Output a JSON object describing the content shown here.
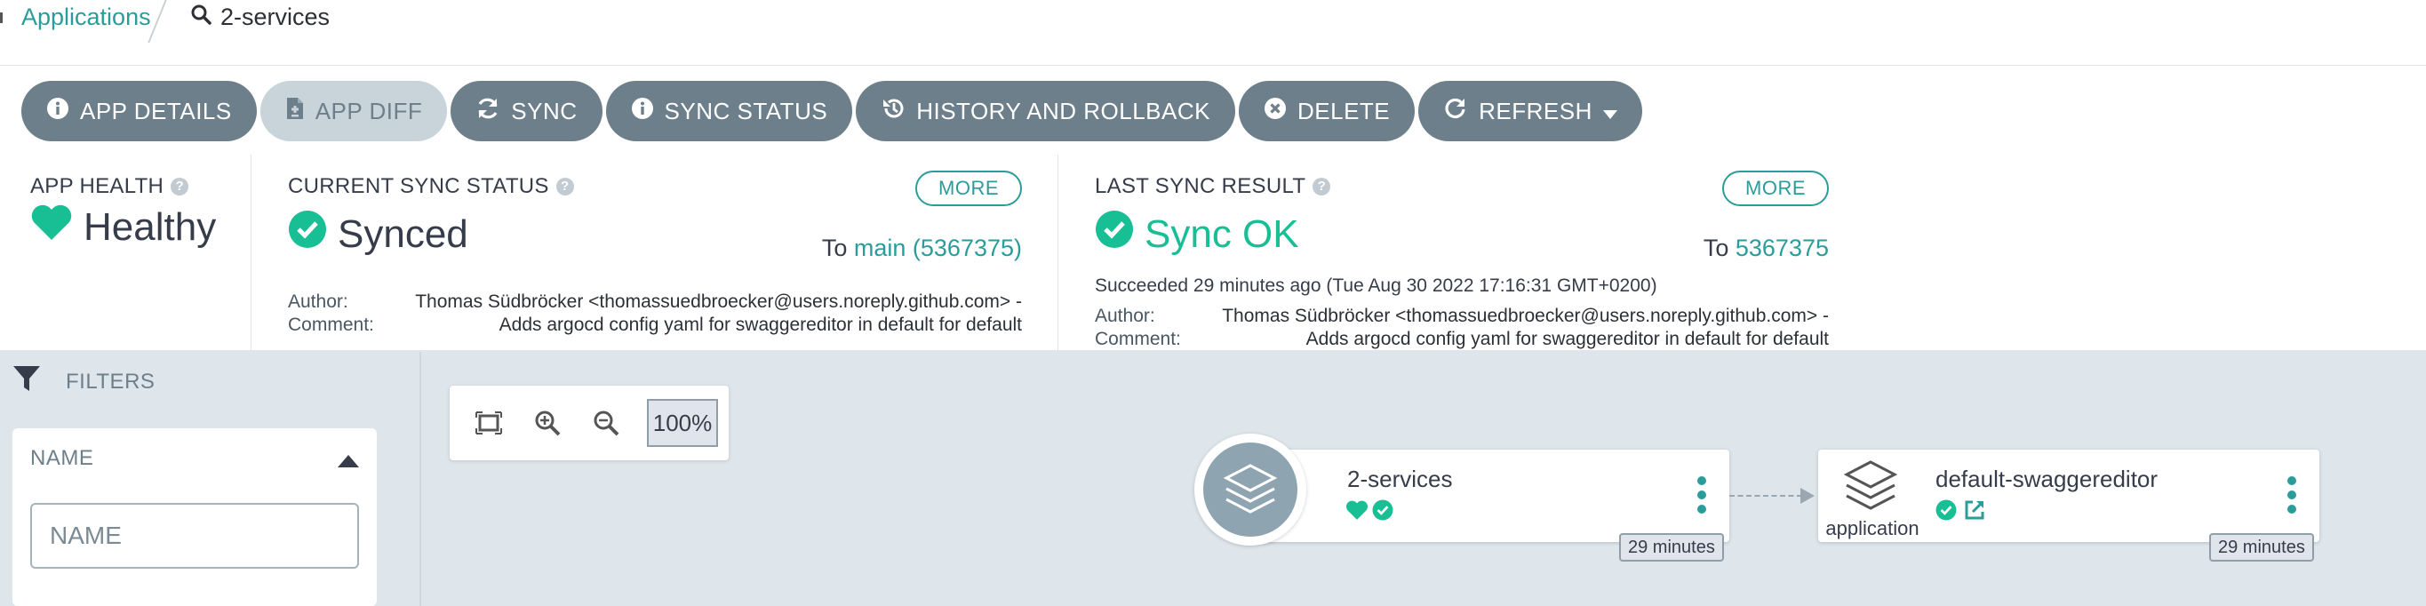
{
  "breadcrumb": {
    "root_label": "Applications",
    "current_label": "2-services"
  },
  "toolbar": {
    "app_details": "APP DETAILS",
    "app_diff": "APP DIFF",
    "sync": "SYNC",
    "sync_status": "SYNC STATUS",
    "history": "HISTORY AND ROLLBACK",
    "delete": "DELETE",
    "refresh": "REFRESH"
  },
  "app_health": {
    "title": "APP HEALTH",
    "value": "Healthy"
  },
  "current_sync": {
    "title": "CURRENT SYNC STATUS",
    "more": "MORE",
    "value": "Synced",
    "to_label": "To",
    "revision": "main (5367375)",
    "author_label": "Author:",
    "author": "Thomas Südbröcker <thomassuedbroecker@users.noreply.github.com> -",
    "comment_label": "Comment:",
    "comment": "Adds argocd config yaml for swaggereditor in default for default"
  },
  "last_sync": {
    "title": "LAST SYNC RESULT",
    "more": "MORE",
    "value": "Sync OK",
    "to_label": "To",
    "revision": "5367375",
    "succeeded": "Succeeded 29 minutes ago (Tue Aug 30 2022 17:16:31 GMT+0200)",
    "author_label": "Author:",
    "author": "Thomas Südbröcker <thomassuedbroecker@users.noreply.github.com> -",
    "comment_label": "Comment:",
    "comment": "Adds argocd config yaml for swaggereditor in default for default"
  },
  "filters": {
    "title": "FILTERS",
    "name_title": "NAME",
    "name_placeholder": "NAME"
  },
  "zoom": {
    "level": "100%"
  },
  "nodes": [
    {
      "name": "2-services",
      "age": "29 minutes"
    },
    {
      "name": "default-swaggereditor",
      "kind": "application",
      "age": "29 minutes"
    }
  ],
  "colors": {
    "teal": "#2a9d9a",
    "healthy_green": "#18be94",
    "button_gray": "#6d7f8b",
    "canvas_bg": "#dee6eb"
  },
  "icons": [
    "search-icon",
    "info-icon",
    "file-diff-icon",
    "sync-icon",
    "history-icon",
    "delete-icon",
    "refresh-icon",
    "heart-icon",
    "check-circle-icon",
    "filter-icon",
    "fit-icon",
    "zoom-in-icon",
    "zoom-out-icon",
    "layers-icon",
    "external-link-icon"
  ]
}
